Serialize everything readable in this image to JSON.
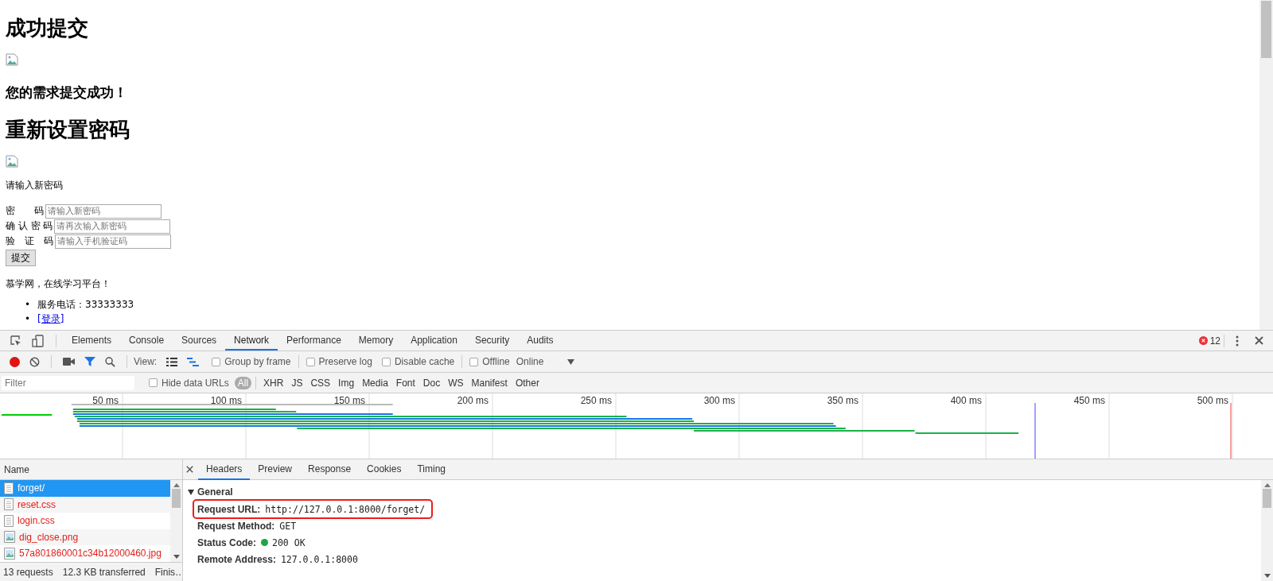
{
  "page": {
    "title": "成功提交",
    "message": "您的需求提交成功！",
    "reset_title": "重新设置密码",
    "prompt": "请输入新密码",
    "fields": [
      {
        "label": "密　　码",
        "placeholder": "请输入新密码"
      },
      {
        "label": "确 认 密 码",
        "placeholder": "请再次输入新密码"
      },
      {
        "label": "验　证　码",
        "placeholder": "请输入手机验证码"
      }
    ],
    "submit": "提交",
    "tagline": "慕学网，在线学习平台！",
    "list": [
      {
        "kind": "text",
        "marker": "•",
        "text": "服务电话：33333333"
      },
      {
        "kind": "link",
        "marker": "•",
        "text": "[登录]"
      }
    ]
  },
  "devtools": {
    "tabs": [
      {
        "label": "Elements",
        "selected": false
      },
      {
        "label": "Console",
        "selected": false
      },
      {
        "label": "Sources",
        "selected": false
      },
      {
        "label": "Network",
        "selected": true
      },
      {
        "label": "Performance",
        "selected": false
      },
      {
        "label": "Memory",
        "selected": false
      },
      {
        "label": "Application",
        "selected": false
      },
      {
        "label": "Security",
        "selected": false
      },
      {
        "label": "Audits",
        "selected": false
      }
    ],
    "error_count": "12",
    "toolbar": {
      "recording": true,
      "filter_on": true,
      "view_label": "View:",
      "throttle": "Online",
      "options": [
        {
          "label": "Group by frame",
          "checked": false
        },
        {
          "label": "Preserve log",
          "checked": false
        },
        {
          "label": "Disable cache",
          "checked": false
        },
        {
          "label": "Offline",
          "checked": false
        }
      ]
    },
    "filter": {
      "placeholder": "Filter",
      "hide_data_urls": {
        "label": "Hide data URLs",
        "checked": false
      },
      "types": [
        {
          "label": "All",
          "selected": true
        },
        {
          "label": "XHR",
          "selected": false
        },
        {
          "label": "JS",
          "selected": false
        },
        {
          "label": "CSS",
          "selected": false
        },
        {
          "label": "Img",
          "selected": false
        },
        {
          "label": "Media",
          "selected": false
        },
        {
          "label": "Font",
          "selected": false
        },
        {
          "label": "Doc",
          "selected": false
        },
        {
          "label": "WS",
          "selected": false
        },
        {
          "label": "Manifest",
          "selected": false
        },
        {
          "label": "Other",
          "selected": false
        }
      ]
    },
    "timeline_ticks": [
      "50 ms",
      "100 ms",
      "150 ms",
      "200 ms",
      "250 ms",
      "300 ms",
      "350 ms",
      "400 ms",
      "450 ms",
      "500 ms"
    ],
    "requests": {
      "header": "Name",
      "items": [
        {
          "name": "forget/",
          "kind": "doc",
          "failed": false,
          "selected": true
        },
        {
          "name": "reset.css",
          "kind": "doc",
          "failed": true,
          "selected": false
        },
        {
          "name": "login.css",
          "kind": "doc",
          "failed": true,
          "selected": false
        },
        {
          "name": "dig_close.png",
          "kind": "image",
          "failed": true,
          "selected": false
        },
        {
          "name": "57a801860001c34b12000460.jpg",
          "kind": "image",
          "failed": true,
          "selected": false
        }
      ]
    },
    "summary": [
      "13 requests",
      "12.3 KB transferred",
      "Finis…"
    ],
    "detail_tabs": [
      {
        "label": "Headers",
        "selected": true
      },
      {
        "label": "Preview",
        "selected": false
      },
      {
        "label": "Response",
        "selected": false
      },
      {
        "label": "Cookies",
        "selected": false
      },
      {
        "label": "Timing",
        "selected": false
      }
    ],
    "general": {
      "title": "General",
      "expanded": true,
      "rows": [
        {
          "key": "Request URL:",
          "value": "http://127.0.0.1:8000/forget/",
          "highlighted": true
        },
        {
          "key": "Request Method:",
          "value": "GET",
          "highlighted": false
        },
        {
          "key": "Status Code:",
          "value": "200 OK",
          "color": "#1ea446",
          "highlighted": false
        },
        {
          "key": "Remote Address:",
          "value": "127.0.0.1:8000",
          "highlighted": false
        }
      ]
    }
  }
}
